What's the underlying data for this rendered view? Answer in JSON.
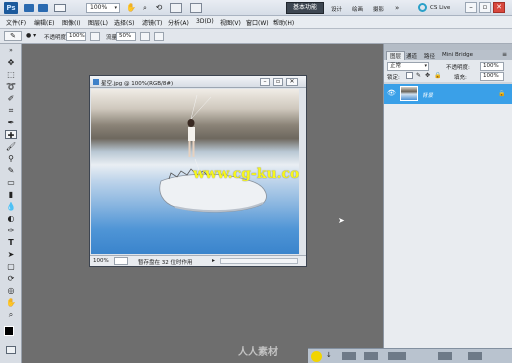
{
  "appbar": {
    "logo": "Ps",
    "zoom": "100%",
    "workspace_button": "基本功能",
    "workspace_items": [
      "设计",
      "绘画",
      "摄影"
    ],
    "cs_live": "CS Live"
  },
  "menubar": {
    "items": [
      "文件(F)",
      "编辑(E)",
      "图像(I)",
      "图层(L)",
      "选择(S)",
      "滤镜(T)",
      "分析(A)",
      "3D(D)",
      "视图(V)",
      "窗口(W)",
      "帮助(H)"
    ]
  },
  "optbar": {
    "opacity_label": "不透明度:",
    "opacity_value": "100%",
    "flow_label": "流量:",
    "flow_value": "50%"
  },
  "document": {
    "title": "星空.jpg @ 100%(RGB/8#)",
    "zoom": "100%",
    "status": "暂存盘在 32 位时作用",
    "watermark": "www.cg-ku.com",
    "colors": {
      "sky_top": "#e6e2dc",
      "ground": "#7c7468",
      "sky_bottom": "#3d88d2",
      "watermark": "#f7f71c"
    }
  },
  "panel": {
    "tabs": [
      "图层",
      "通道",
      "路径",
      "Mini Bridge"
    ],
    "blend_mode": "正常",
    "opacity_label": "不透明度:",
    "opacity_value": "100%",
    "lock_label": "锁定:",
    "fill_label": "填充:",
    "fill_value": "100%",
    "layer_name": "背景",
    "accent": "#3aa0e8"
  },
  "footer": {
    "watermark": "人人素材"
  }
}
